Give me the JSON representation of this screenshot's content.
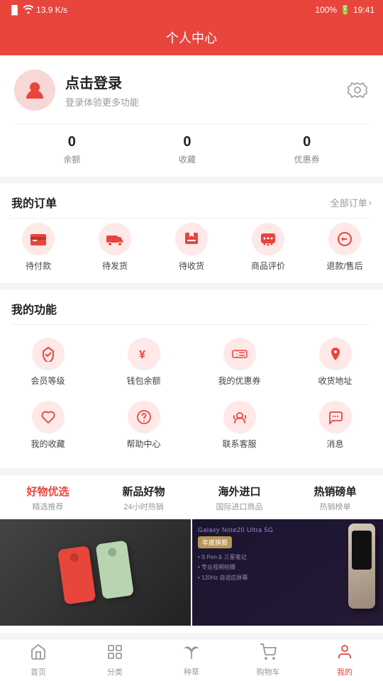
{
  "statusBar": {
    "signal": "46",
    "wifi": "wifi",
    "speed": "13.9 K/s",
    "battery": "100%",
    "time": "19:41"
  },
  "header": {
    "title": "个人中心"
  },
  "profile": {
    "loginText": "点击登录",
    "loginSubtitle": "登录体验更多功能",
    "stats": [
      {
        "value": "0",
        "label": "余额"
      },
      {
        "value": "0",
        "label": "收藏"
      },
      {
        "value": "0",
        "label": "优惠券"
      }
    ]
  },
  "orders": {
    "title": "我的订单",
    "more": "全部订单",
    "items": [
      {
        "label": "待付款",
        "icon": "💳"
      },
      {
        "label": "待发货",
        "icon": "🚚"
      },
      {
        "label": "待收货",
        "icon": "📦"
      },
      {
        "label": "商品评价",
        "icon": "💬"
      },
      {
        "label": "退款/售后",
        "icon": "↩️"
      }
    ]
  },
  "features": {
    "title": "我的功能",
    "items": [
      {
        "label": "会员等级",
        "icon": "💎"
      },
      {
        "label": "钱包余额",
        "icon": "¥"
      },
      {
        "label": "我的优惠券",
        "icon": "🎫"
      },
      {
        "label": "收货地址",
        "icon": "📍"
      },
      {
        "label": "我的收藏",
        "icon": "⭐"
      },
      {
        "label": "帮助中心",
        "icon": "❓"
      },
      {
        "label": "联系客服",
        "icon": "🎧"
      },
      {
        "label": "消息",
        "icon": "💭"
      }
    ]
  },
  "categories": [
    {
      "name": "好物优选",
      "sub": "精选推荐",
      "active": true
    },
    {
      "name": "新品好物",
      "sub": "24小时热销",
      "active": false
    },
    {
      "name": "海外进口",
      "sub": "国际进口商品",
      "active": false
    },
    {
      "name": "热销磅单",
      "sub": "热销榜单",
      "active": false
    }
  ],
  "products": [
    {
      "id": "left",
      "type": "phones"
    },
    {
      "id": "right",
      "brand": "Galaxy Note20 Ultra 5G",
      "tag": "年度旗舰",
      "features": [
        "S Pen & 三星笔记",
        "专业视频拍摄",
        "120Hz 自适应屏幕"
      ]
    }
  ],
  "bottomNav": [
    {
      "label": "首页",
      "icon": "🏠",
      "active": false
    },
    {
      "label": "分类",
      "icon": "⊞",
      "active": false
    },
    {
      "label": "种草",
      "icon": "🌿",
      "active": false
    },
    {
      "label": "购物车",
      "icon": "🛒",
      "active": false
    },
    {
      "label": "我的",
      "icon": "👤",
      "active": true
    }
  ]
}
